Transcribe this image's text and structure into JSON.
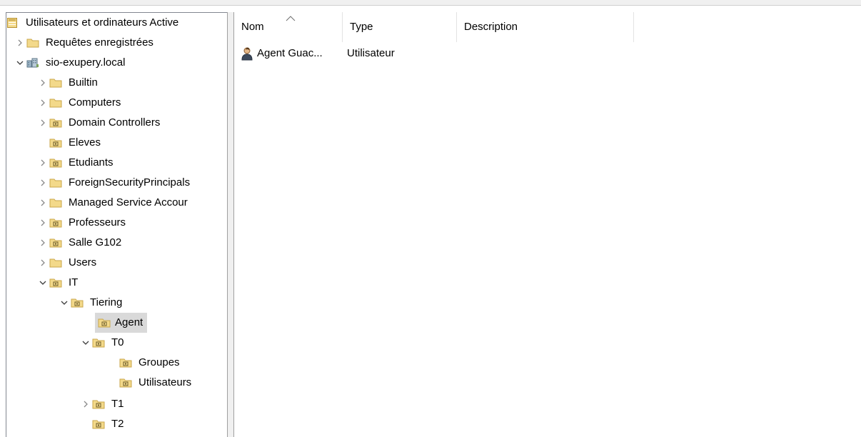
{
  "tree": {
    "items": [
      {
        "label": "Utilisateurs et ordinateurs Active",
        "icon": "snapin-root-icon",
        "expander": "none"
      },
      {
        "label": "Requêtes enregistrées",
        "icon": "folder-icon",
        "expander": "collapsed"
      },
      {
        "label": "sio-exupery.local",
        "icon": "domain-icon",
        "expander": "expanded"
      },
      {
        "label": "Builtin",
        "icon": "folder-icon",
        "expander": "collapsed"
      },
      {
        "label": "Computers",
        "icon": "folder-icon",
        "expander": "collapsed"
      },
      {
        "label": "Domain Controllers",
        "icon": "ou-icon",
        "expander": "collapsed"
      },
      {
        "label": "Eleves",
        "icon": "ou-icon",
        "expander": "none"
      },
      {
        "label": "Etudiants",
        "icon": "ou-icon",
        "expander": "collapsed"
      },
      {
        "label": "ForeignSecurityPrincipals",
        "icon": "folder-icon",
        "expander": "collapsed"
      },
      {
        "label": "Managed Service Accour",
        "icon": "folder-icon",
        "expander": "collapsed"
      },
      {
        "label": "Professeurs",
        "icon": "ou-icon",
        "expander": "collapsed"
      },
      {
        "label": "Salle G102",
        "icon": "ou-icon",
        "expander": "collapsed"
      },
      {
        "label": "Users",
        "icon": "folder-icon",
        "expander": "collapsed"
      },
      {
        "label": "IT",
        "icon": "ou-icon",
        "expander": "expanded"
      },
      {
        "label": "Tiering",
        "icon": "ou-icon",
        "expander": "expanded"
      },
      {
        "label": "Agent",
        "icon": "ou-icon",
        "expander": "none",
        "selected": true
      },
      {
        "label": "T0",
        "icon": "ou-icon",
        "expander": "expanded"
      },
      {
        "label": "Groupes",
        "icon": "ou-icon",
        "expander": "none"
      },
      {
        "label": "Utilisateurs",
        "icon": "ou-icon",
        "expander": "none"
      },
      {
        "label": "T1",
        "icon": "ou-icon",
        "expander": "collapsed"
      },
      {
        "label": "T2",
        "icon": "ou-icon",
        "expander": "none"
      }
    ]
  },
  "list": {
    "columns": [
      {
        "label": "Nom",
        "sorted": true
      },
      {
        "label": "Type"
      },
      {
        "label": "Description"
      }
    ],
    "rows": [
      {
        "name": "Agent Guac...",
        "type": "Utilisateur",
        "description": "",
        "icon": "user-icon"
      }
    ]
  },
  "colors": {
    "folder": "#f3d98a",
    "folder_edge": "#c9a64a",
    "ou_mark": "#6b5a2a",
    "selection": "#d9d9d9",
    "user": "#3d4a5c"
  }
}
